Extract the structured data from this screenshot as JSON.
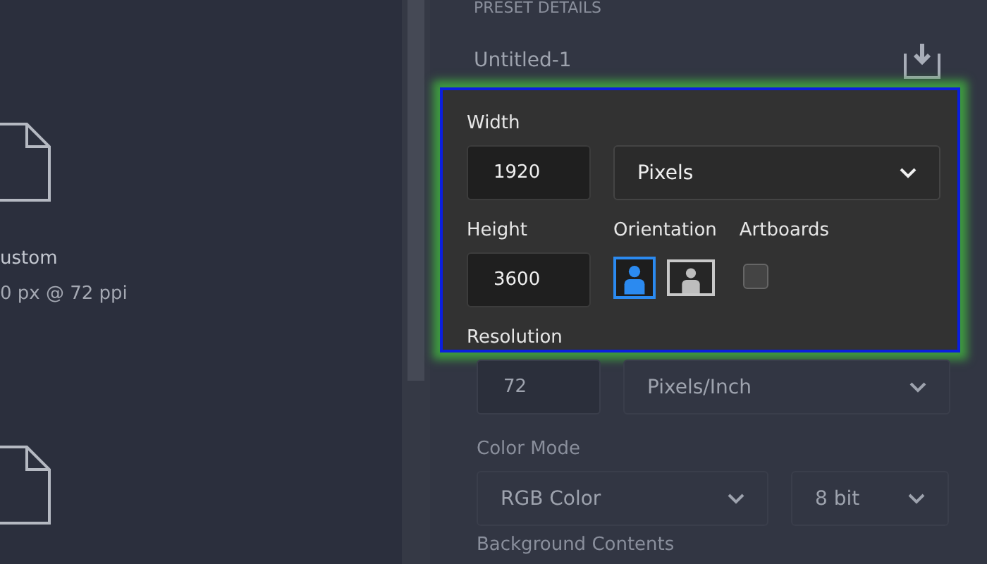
{
  "presets": [
    {
      "kind": "labeled",
      "name": "ustom",
      "details": "0 px @ 72 ppi"
    },
    {
      "kind": "unlabeled"
    }
  ],
  "preset_details": {
    "heading": "PRESET DETAILS",
    "title": "Untitled-1",
    "width": {
      "label": "Width",
      "value": "1920",
      "unit": "Pixels"
    },
    "height": {
      "label": "Height",
      "value": "3600"
    },
    "orientation": {
      "label": "Orientation",
      "options": [
        {
          "kind": "portrait",
          "selected": true
        },
        {
          "kind": "landscape",
          "selected": false
        }
      ]
    },
    "artboards": {
      "label": "Artboards",
      "checked": false
    },
    "resolution": {
      "label": "Resolution",
      "value": "72",
      "unit": "Pixels/Inch"
    },
    "color_mode": {
      "label": "Color Mode",
      "mode": "RGB Color",
      "depth": "8 bit"
    },
    "background_contents": {
      "label": "Background Contents"
    }
  }
}
